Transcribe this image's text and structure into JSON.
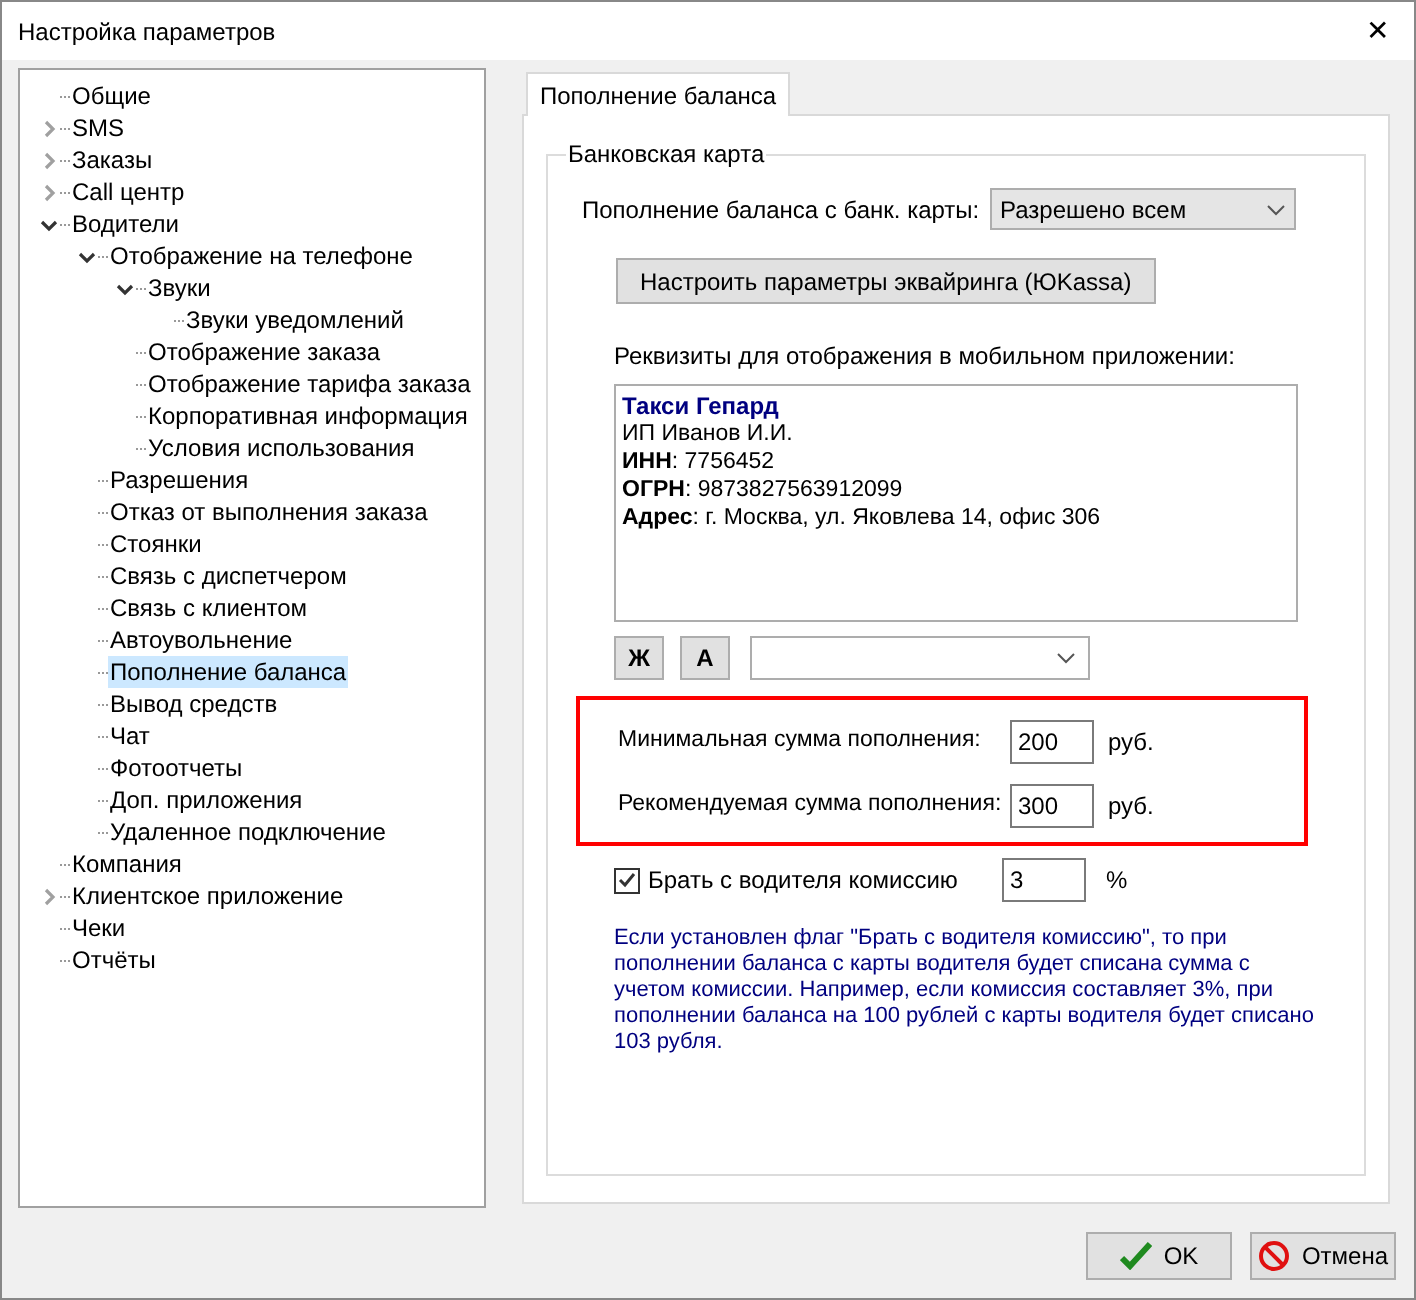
{
  "window": {
    "title": "Настройка параметров",
    "close": "✕"
  },
  "tree": [
    {
      "label": "Общие",
      "kind": "leaf",
      "selected": false
    },
    {
      "label": "SMS",
      "kind": "branch",
      "expanded": false,
      "selected": false
    },
    {
      "label": "Заказы",
      "kind": "branch",
      "expanded": false,
      "selected": false
    },
    {
      "label": "Call центр",
      "kind": "branch",
      "expanded": false,
      "selected": false
    },
    {
      "label": "Водители",
      "kind": "branch",
      "expanded": true,
      "selected": false,
      "children": [
        {
          "label": "Отображение на телефоне",
          "kind": "branch",
          "expanded": true,
          "selected": false,
          "children": [
            {
              "label": "Звуки",
              "kind": "branch",
              "expanded": true,
              "selected": false,
              "children": [
                {
                  "label": "Звуки уведомлений",
                  "kind": "leaf",
                  "selected": false
                }
              ]
            },
            {
              "label": "Отображение заказа",
              "kind": "leaf",
              "selected": false
            },
            {
              "label": "Отображение тарифа заказа",
              "kind": "leaf",
              "selected": false
            },
            {
              "label": "Корпоративная информация",
              "kind": "leaf",
              "selected": false
            },
            {
              "label": "Условия использования",
              "kind": "leaf",
              "selected": false
            }
          ]
        },
        {
          "label": "Разрешения",
          "kind": "leaf",
          "selected": false
        },
        {
          "label": "Отказ от выполнения заказа",
          "kind": "leaf",
          "selected": false
        },
        {
          "label": "Стоянки",
          "kind": "leaf",
          "selected": false
        },
        {
          "label": "Связь с диспетчером",
          "kind": "leaf",
          "selected": false
        },
        {
          "label": "Связь с клиентом",
          "kind": "leaf",
          "selected": false
        },
        {
          "label": "Автоувольнение",
          "kind": "leaf",
          "selected": false
        },
        {
          "label": "Пополнение баланса",
          "kind": "leaf",
          "selected": true
        },
        {
          "label": "Вывод средств",
          "kind": "leaf",
          "selected": false
        },
        {
          "label": "Чат",
          "kind": "leaf",
          "selected": false
        },
        {
          "label": "Фотоотчеты",
          "kind": "leaf",
          "selected": false
        },
        {
          "label": "Доп. приложения",
          "kind": "leaf",
          "selected": false
        },
        {
          "label": "Удаленное подключение",
          "kind": "leaf",
          "selected": false
        }
      ]
    },
    {
      "label": "Компания",
      "kind": "leaf",
      "selected": false
    },
    {
      "label": "Клиентское приложение",
      "kind": "branch",
      "expanded": false,
      "selected": false
    },
    {
      "label": "Чеки",
      "kind": "leaf",
      "selected": false
    },
    {
      "label": "Отчёты",
      "kind": "leaf",
      "selected": false
    }
  ],
  "tabs": [
    {
      "label": "Пополнение баланса",
      "selected": true
    }
  ],
  "group": {
    "title": "Банковская карта",
    "topup_mode": {
      "label": "Пополнение баланса с банк. карты:",
      "value": "Разрешено всем"
    },
    "acquiring_button": "Настроить параметры эквайринга (ЮKassa)",
    "requisites_label": "Реквизиты для отображения в мобильном приложении:",
    "requisites": [
      {
        "kind": "title",
        "text": "Такси Гепард"
      },
      {
        "kind": "line",
        "text": "ИП Иванов И.И."
      },
      {
        "kind": "line",
        "text": "**ИНН**: 7756452"
      },
      {
        "kind": "line",
        "text": "**ОГРН**: 9873827563912099"
      },
      {
        "kind": "line",
        "text": "**Адрес**: г. Москва, ул. Яковлева 14, офис 306"
      }
    ],
    "format_buttons": [
      "Ж",
      "А"
    ],
    "amounts": {
      "highlighted": true,
      "rows": [
        {
          "label": "Минимальная сумма пополнения:",
          "value": "200",
          "unit": "руб."
        },
        {
          "label": "Рекомендуемая сумма пополнения:",
          "value": "300",
          "unit": "руб."
        }
      ]
    },
    "commission": {
      "label": "Брать с водителя комиссию",
      "checked": true,
      "value": "3",
      "unit": "%"
    },
    "note": "Если установлен флаг \"Брать с водителя комиссию\", то при пополнении баланса с карты водителя будет списана сумма с учетом комиссии. Например, если комиссия составляет 3%, при пополнении баланса на 100 рублей с карты водителя будет списано 103 рубля."
  },
  "buttons": [
    {
      "kind": "ok",
      "label": "OK"
    },
    {
      "kind": "cancel",
      "label": "Отмена"
    }
  ]
}
